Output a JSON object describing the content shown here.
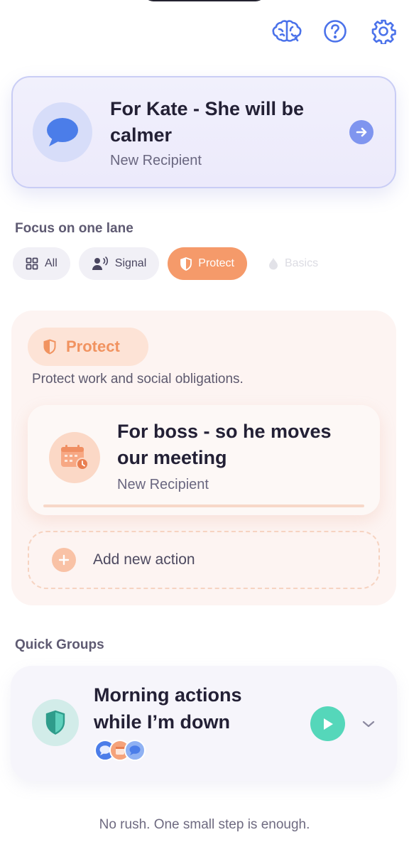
{
  "header": {
    "icons": [
      "brain-icon",
      "help-icon",
      "gear-icon"
    ]
  },
  "recipient_card": {
    "title": "For Kate - She will be calmer",
    "subtitle": "New Recipient",
    "avatar_icon": "chat-bubble-icon",
    "action_icon": "arrow-right-icon"
  },
  "focus": {
    "label": "Focus on one lane",
    "chips": [
      {
        "label": "All",
        "icon": "grid-icon",
        "state": "default"
      },
      {
        "label": "Signal",
        "icon": "speaker-icon",
        "state": "default"
      },
      {
        "label": "Protect",
        "icon": "shield-icon",
        "state": "selected"
      },
      {
        "label": "Basics",
        "icon": "drop-icon",
        "state": "faded"
      }
    ]
  },
  "lane": {
    "badge": "Protect",
    "description": "Protect work and social obligations.",
    "action": {
      "title": "For boss - so he moves our meeting",
      "subtitle": "New Recipient",
      "icon": "calendar-clock-icon"
    },
    "add_label": "Add new action"
  },
  "quick_groups": {
    "label": "Quick Groups",
    "group": {
      "title": "Morning actions while I’m down",
      "icon": "shield-icon",
      "member_icons": [
        "chat-bubble-icon",
        "calendar-icon",
        "chat-bubble-icon"
      ]
    }
  },
  "footer": {
    "note": "No rush. One small step is enough."
  },
  "colors": {
    "accent_blue": "#7f95ef",
    "protect_orange": "#f59a6a",
    "play_green": "#55d7ba"
  }
}
